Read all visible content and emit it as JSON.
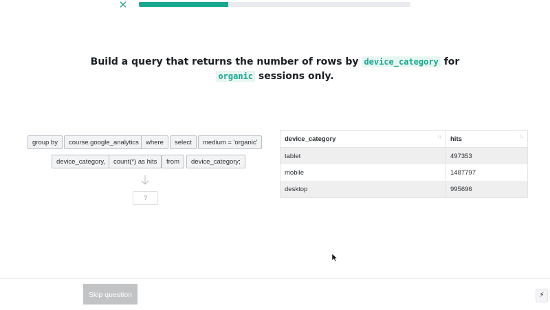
{
  "header": {
    "close_glyph": "✕",
    "progress": 0.33
  },
  "question": {
    "prefix": "Build a query that returns the number of rows by",
    "code1": "device_category",
    "mid": "for",
    "code2": "organic",
    "suffix": "sessions only."
  },
  "tokens": [
    "group by",
    "course.google_analytics",
    "where",
    "select",
    "medium = 'organic'",
    "device_category,",
    "count(*) as hits",
    "from",
    "device_category;"
  ],
  "drop_slot": {
    "placeholder": "?"
  },
  "results": {
    "columns": [
      "device_category",
      "hits"
    ],
    "rows": [
      [
        "tablet",
        "497353"
      ],
      [
        "mobile",
        "1487797"
      ],
      [
        "desktop",
        "995696"
      ]
    ],
    "sort_glyph": "↑↓"
  },
  "footer": {
    "skip_label": "Skip question",
    "bolt_glyph": "⚡"
  },
  "colors": {
    "accent": "#17a88f",
    "code_bg": "#e8f6f2",
    "skip_bg": "#c1c3c5"
  }
}
